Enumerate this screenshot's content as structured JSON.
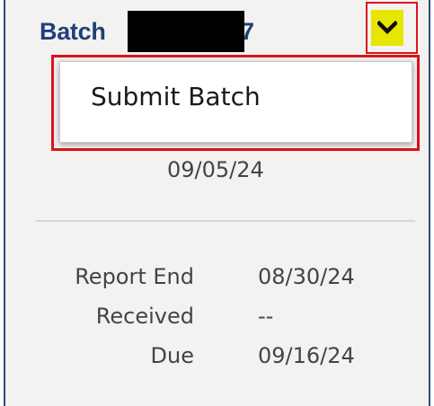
{
  "header": {
    "title": "Batch",
    "title_tail": "7"
  },
  "menu": {
    "items": [
      {
        "label": "Submit Batch"
      }
    ]
  },
  "main": {
    "date": "09/05/24",
    "details": [
      {
        "label": "Report End",
        "value": "08/30/24"
      },
      {
        "label": "Received",
        "value": "--"
      },
      {
        "label": "Due",
        "value": "09/16/24"
      }
    ]
  },
  "colors": {
    "title": "#1f3f7a",
    "highlight": "#e6e600",
    "annotation_border": "#d9141c",
    "panel_bg": "#f3f2f0"
  },
  "icons": {
    "dropdown": "chevron-down-icon"
  }
}
